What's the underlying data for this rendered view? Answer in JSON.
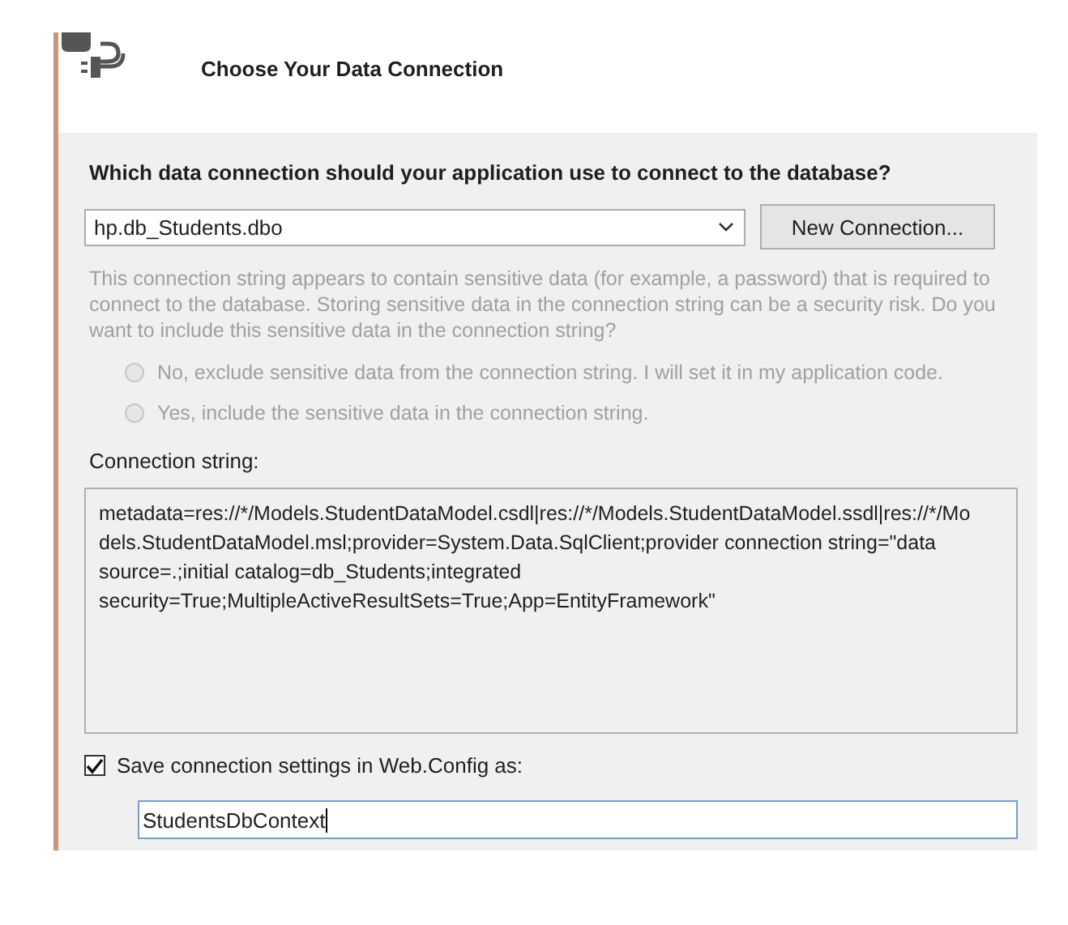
{
  "header": {
    "title": "Choose Your Data Connection"
  },
  "question": "Which data connection should your application use to connect to the database?",
  "connection_select": {
    "value": "hp.db_Students.dbo"
  },
  "new_connection_button": "New Connection...",
  "sensitive": {
    "disabled": true,
    "text": "This connection string appears to contain sensitive data (for example, a password) that is required to connect to the database. Storing sensitive data in the connection string can be a security risk. Do you want to include this sensitive data in the connection string?",
    "options": [
      {
        "label": "No, exclude sensitive data from the connection string. I will set it in my application code.",
        "selected": false
      },
      {
        "label": "Yes, include the sensitive data in the connection string.",
        "selected": false
      }
    ]
  },
  "connection_string": {
    "label": "Connection string:",
    "value": "metadata=res://*/Models.StudentDataModel.csdl|res://*/Models.StudentDataModel.ssdl|res://*/Models.StudentDataModel.msl;provider=System.Data.SqlClient;provider connection string=\"data source=.;initial catalog=db_Students;integrated security=True;MultipleActiveResultSets=True;App=EntityFramework\""
  },
  "save_settings": {
    "label": "Save connection settings in Web.Config as:",
    "checked": true,
    "value": "StudentsDbContext"
  }
}
